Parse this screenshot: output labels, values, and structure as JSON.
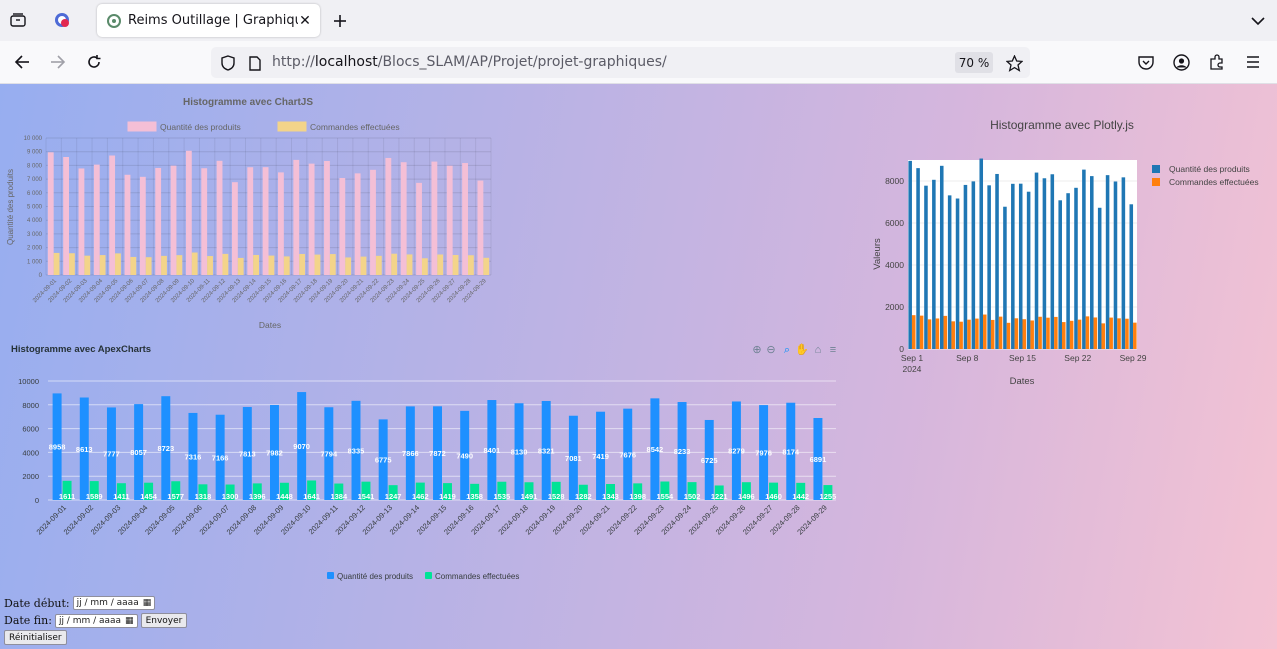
{
  "browser": {
    "tab_title": "Reims Outillage | Graphiques",
    "url_prefix": "http://",
    "url_host": "localhost",
    "url_path": "/Blocs_SLAM/AP/Projet/projet-graphiques/",
    "zoom": "70 %"
  },
  "form": {
    "date_debut_label": "Date début:",
    "date_fin_label": "Date fin:",
    "date_placeholder": "jj / mm / aaaa",
    "envoyer_label": "Envoyer",
    "reinitialiser_label": "Réinitialiser"
  },
  "chart_data": [
    {
      "id": "chartjs",
      "type": "bar",
      "title": "Histogramme avec ChartJS",
      "xlabel": "Dates",
      "ylabel": "Quantité des produits",
      "ylim": [
        0,
        10000
      ],
      "yticks": [
        "0",
        "1 000",
        "2 000",
        "3 000",
        "4 000",
        "5 000",
        "6 000",
        "7 000",
        "8 000",
        "9 000",
        "10 000"
      ],
      "legend_position": "top",
      "categories": [
        "2024-09-01",
        "2024-09-02",
        "2024-09-03",
        "2024-09-04",
        "2024-09-05",
        "2024-09-06",
        "2024-09-07",
        "2024-09-08",
        "2024-09-09",
        "2024-09-10",
        "2024-09-11",
        "2024-09-12",
        "2024-09-13",
        "2024-09-14",
        "2024-09-15",
        "2024-09-16",
        "2024-09-17",
        "2024-09-18",
        "2024-09-19",
        "2024-09-20",
        "2024-09-21",
        "2024-09-22",
        "2024-09-23",
        "2024-09-24",
        "2024-09-25",
        "2024-09-26",
        "2024-09-27",
        "2024-09-28",
        "2024-09-29"
      ],
      "series": [
        {
          "name": "Quantité des produits",
          "color": "#f4bfd6",
          "values": [
            8958,
            8613,
            7777,
            8057,
            8723,
            7316,
            7166,
            7813,
            7982,
            9070,
            7794,
            8335,
            6775,
            7866,
            7872,
            7490,
            8401,
            8130,
            8321,
            7081,
            7419,
            7676,
            8542,
            8233,
            6725,
            8279,
            7976,
            8174,
            6891
          ]
        },
        {
          "name": "Commandes effectuées",
          "color": "#f3d48a",
          "values": [
            1611,
            1589,
            1411,
            1454,
            1577,
            1318,
            1300,
            1396,
            1448,
            1641,
            1384,
            1541,
            1247,
            1462,
            1419,
            1358,
            1535,
            1491,
            1528,
            1282,
            1343,
            1398,
            1554,
            1502,
            1221,
            1496,
            1460,
            1442,
            1255
          ]
        }
      ]
    },
    {
      "id": "apexcharts",
      "type": "bar",
      "title": "Histogramme avec ApexCharts",
      "ylim": [
        0,
        10000
      ],
      "yticks": [
        "0",
        "2000",
        "4000",
        "6000",
        "8000",
        "10000"
      ],
      "legend_position": "bottom",
      "data_labels": true,
      "categories": [
        "2024-09-01",
        "2024-09-02",
        "2024-09-03",
        "2024-09-04",
        "2024-09-05",
        "2024-09-06",
        "2024-09-07",
        "2024-09-08",
        "2024-09-09",
        "2024-09-10",
        "2024-09-11",
        "2024-09-12",
        "2024-09-13",
        "2024-09-14",
        "2024-09-15",
        "2024-09-16",
        "2024-09-17",
        "2024-09-18",
        "2024-09-19",
        "2024-09-20",
        "2024-09-21",
        "2024-09-22",
        "2024-09-23",
        "2024-09-24",
        "2024-09-25",
        "2024-09-26",
        "2024-09-27",
        "2024-09-28",
        "2024-09-29"
      ],
      "toolbar_icons": [
        "zoom-in-icon",
        "zoom-out-icon",
        "magnifier-icon",
        "pan-hand-icon",
        "home-icon",
        "menu-icon"
      ],
      "series": [
        {
          "name": "Quantité des produits",
          "color": "#1e90ff",
          "values": [
            8958,
            8613,
            7777,
            8057,
            8723,
            7316,
            7166,
            7813,
            7982,
            9070,
            7794,
            8335,
            6775,
            7866,
            7872,
            7490,
            8401,
            8130,
            8321,
            7081,
            7419,
            7676,
            8542,
            8233,
            6725,
            8279,
            7976,
            8174,
            6891
          ]
        },
        {
          "name": "Commandes effectuées",
          "color": "#00e396",
          "values": [
            1611,
            1589,
            1411,
            1454,
            1577,
            1318,
            1300,
            1396,
            1448,
            1641,
            1384,
            1541,
            1247,
            1462,
            1419,
            1358,
            1535,
            1491,
            1528,
            1282,
            1343,
            1398,
            1554,
            1502,
            1221,
            1496,
            1460,
            1442,
            1255
          ]
        }
      ]
    },
    {
      "id": "plotly",
      "type": "bar",
      "title": "Histogramme avec Plotly.js",
      "xlabel": "Dates",
      "ylabel": "Valeurs",
      "ylim": [
        0,
        9000
      ],
      "yticks": [
        "0",
        "2000",
        "4000",
        "6000",
        "8000"
      ],
      "xticks": [
        "Sep 1",
        "Sep 8",
        "Sep 15",
        "Sep 22",
        "Sep 29"
      ],
      "xtick_year": "2024",
      "legend_position": "right",
      "categories": [
        "2024-09-01",
        "2024-09-02",
        "2024-09-03",
        "2024-09-04",
        "2024-09-05",
        "2024-09-06",
        "2024-09-07",
        "2024-09-08",
        "2024-09-09",
        "2024-09-10",
        "2024-09-11",
        "2024-09-12",
        "2024-09-13",
        "2024-09-14",
        "2024-09-15",
        "2024-09-16",
        "2024-09-17",
        "2024-09-18",
        "2024-09-19",
        "2024-09-20",
        "2024-09-21",
        "2024-09-22",
        "2024-09-23",
        "2024-09-24",
        "2024-09-25",
        "2024-09-26",
        "2024-09-27",
        "2024-09-28",
        "2024-09-29"
      ],
      "series": [
        {
          "name": "Quantité des produits",
          "color": "#1f77b4",
          "values": [
            8958,
            8613,
            7777,
            8057,
            8723,
            7316,
            7166,
            7813,
            7982,
            9070,
            7794,
            8335,
            6775,
            7866,
            7872,
            7490,
            8401,
            8130,
            8321,
            7081,
            7419,
            7676,
            8542,
            8233,
            6725,
            8279,
            7976,
            8174,
            6891
          ]
        },
        {
          "name": "Commandes effectuées",
          "color": "#ff7f0e",
          "values": [
            1611,
            1589,
            1411,
            1454,
            1577,
            1318,
            1300,
            1396,
            1448,
            1641,
            1384,
            1541,
            1247,
            1462,
            1419,
            1358,
            1535,
            1491,
            1528,
            1282,
            1343,
            1398,
            1554,
            1502,
            1221,
            1496,
            1460,
            1442,
            1255
          ]
        }
      ]
    }
  ]
}
